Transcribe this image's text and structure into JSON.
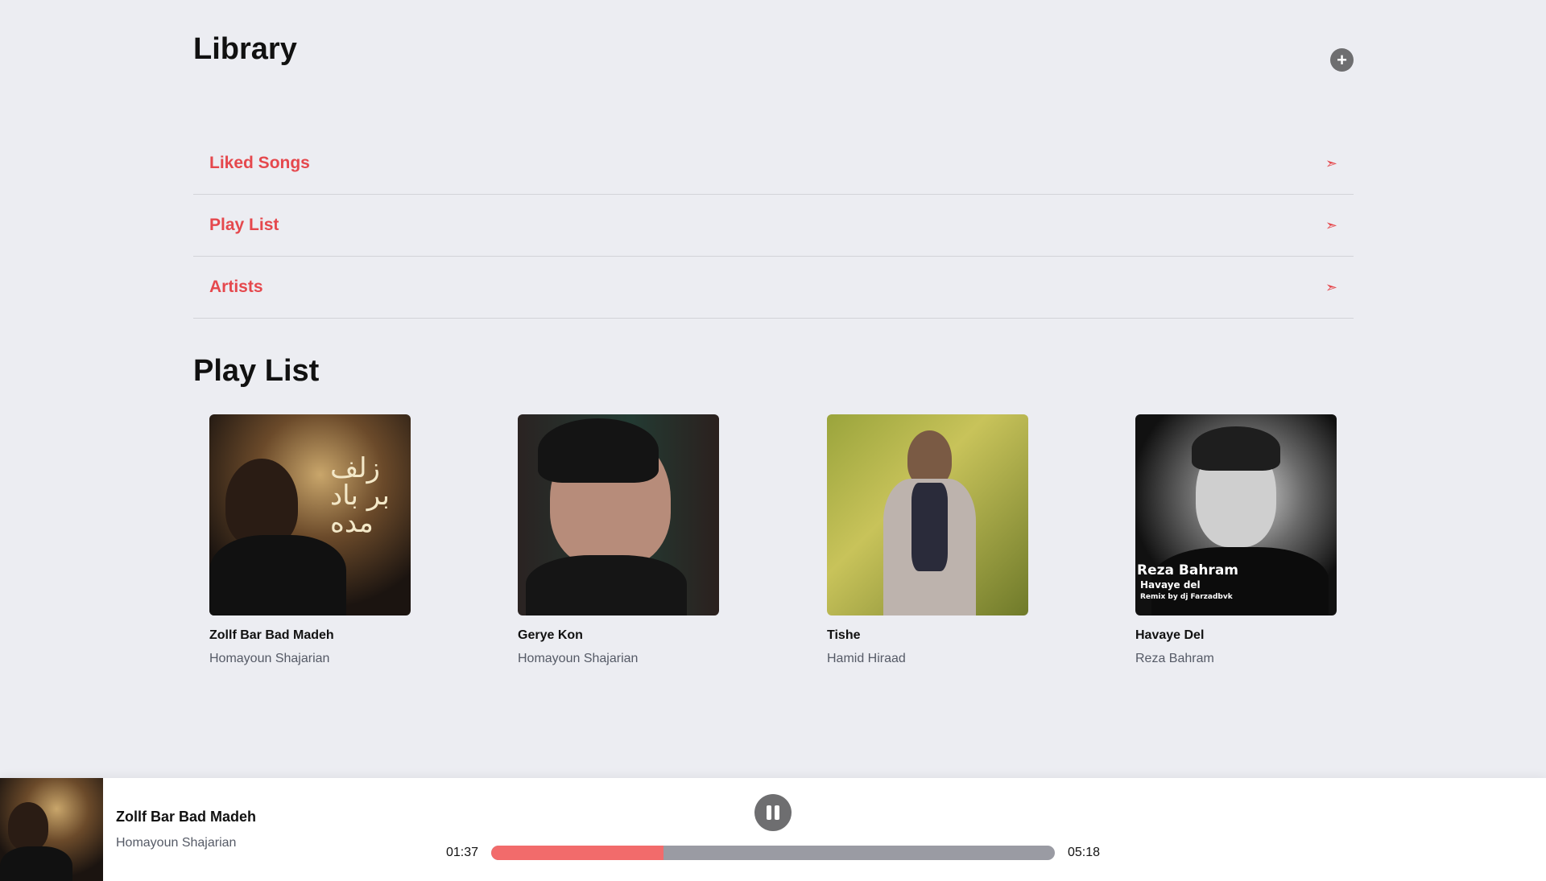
{
  "library": {
    "title": "Library",
    "add_button": "+",
    "items": [
      {
        "label": "Liked Songs",
        "arrow": "➣"
      },
      {
        "label": "Play List",
        "arrow": "➣"
      },
      {
        "label": "Artists",
        "arrow": "➣"
      }
    ]
  },
  "playlist": {
    "title": "Play List",
    "songs": [
      {
        "title": "Zollf Bar Bad Madeh",
        "artist": "Homayoun Shajarian",
        "cover_text": "زلف بر باد مده"
      },
      {
        "title": "Gerye Kon",
        "artist": "Homayoun Shajarian"
      },
      {
        "title": "Tishe",
        "artist": "Hamid Hiraad"
      },
      {
        "title": "Havaye Del",
        "artist": "Reza Bahram",
        "cover_name": "Reza Bahram",
        "cover_sub": "Havaye del",
        "cover_remix": "Remix by dj Farzadbvk"
      }
    ]
  },
  "player": {
    "title": "Zollf Bar Bad Madeh",
    "artist": "Homayoun Shajarian",
    "current_time": "01:37",
    "duration": "05:18",
    "progress": 0.305,
    "state": "playing"
  },
  "colors": {
    "accent": "#e5484d",
    "progress_fill": "#f26b6b",
    "progress_track": "#9a9ba3",
    "background": "#ecedf2"
  }
}
